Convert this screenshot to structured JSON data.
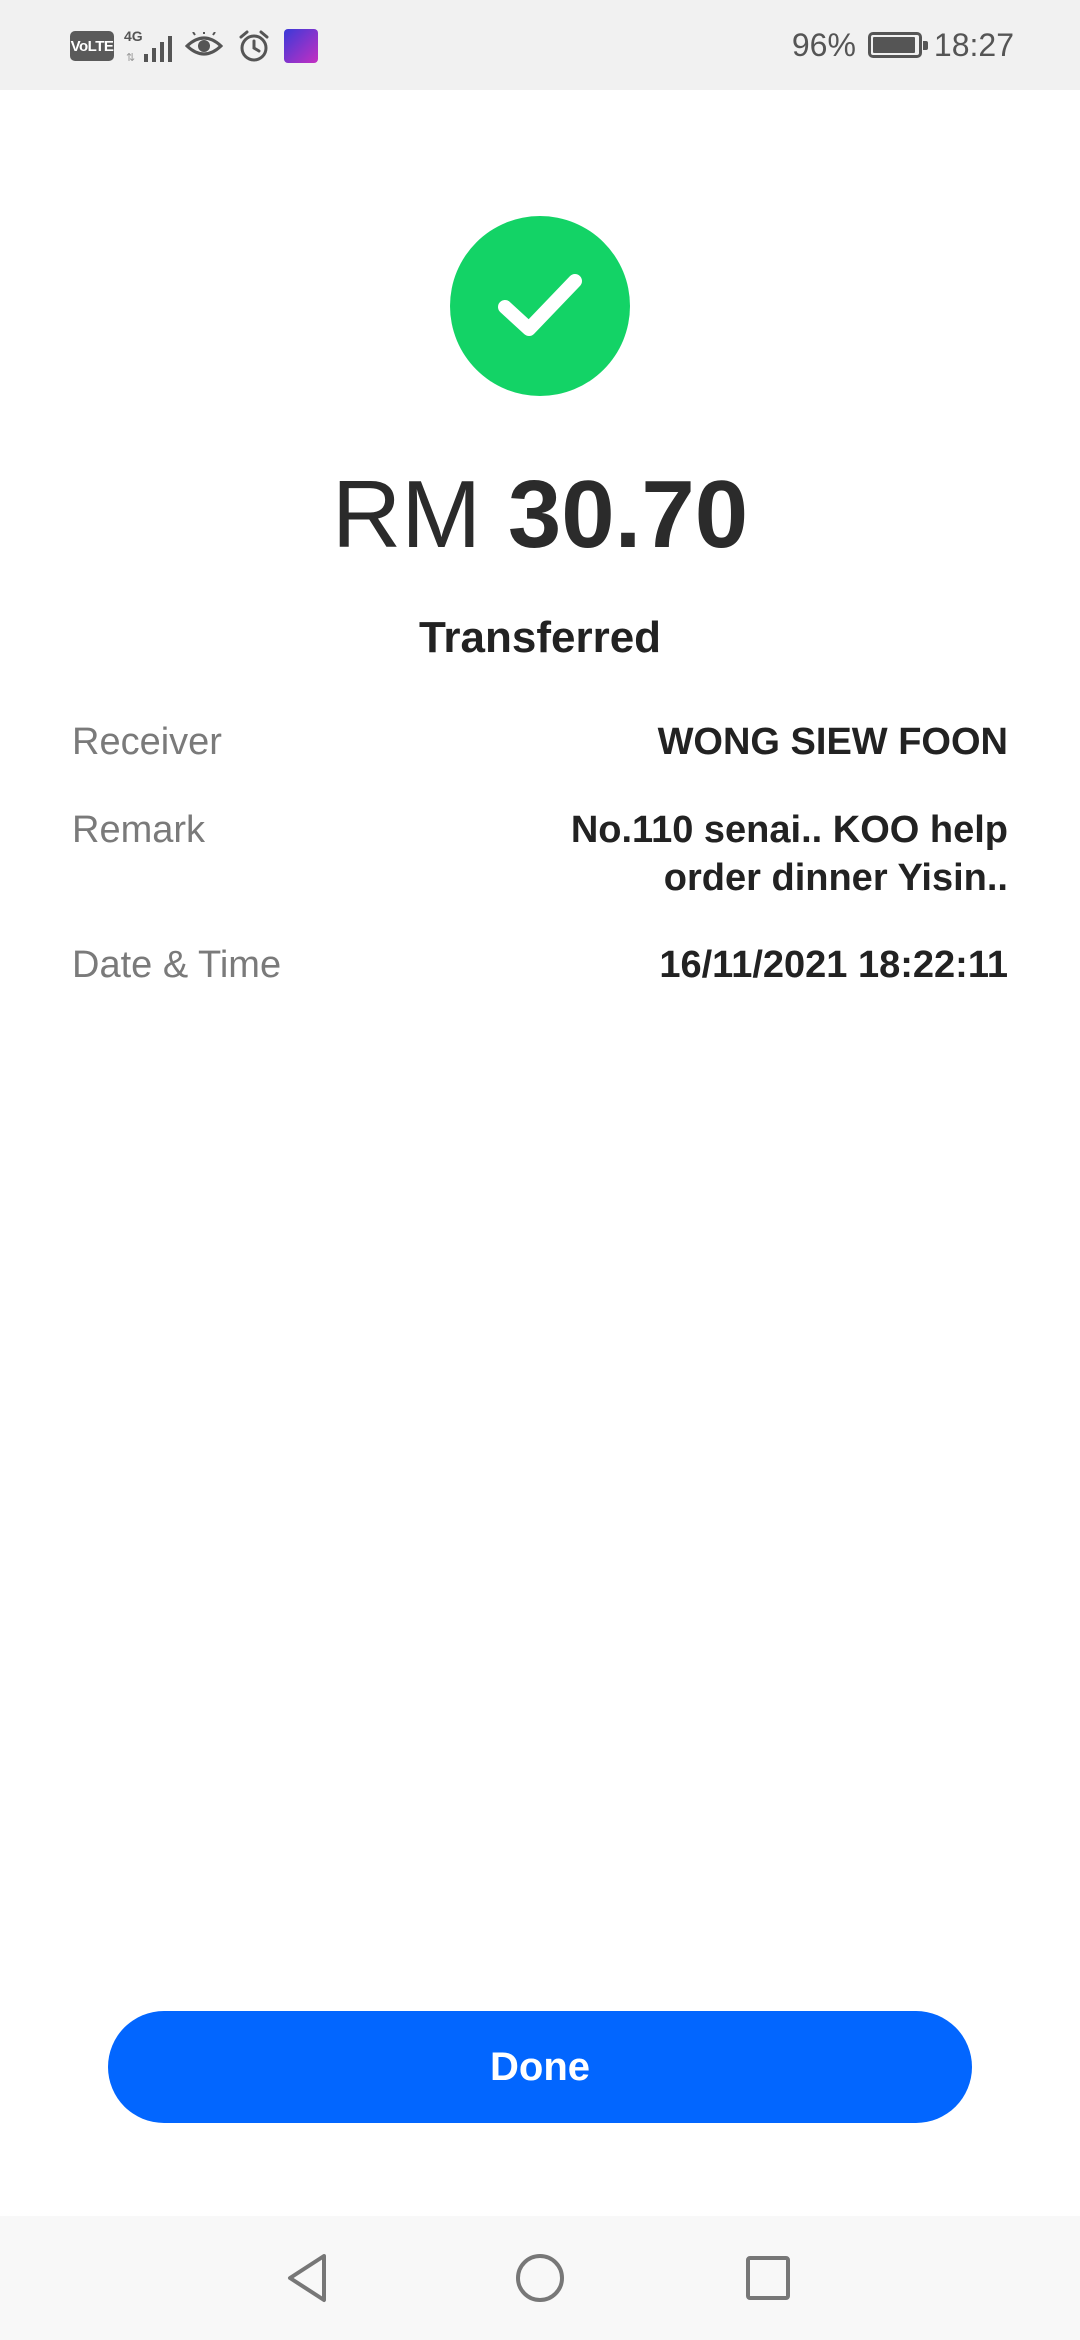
{
  "status_bar": {
    "volte_label": "VoLTE",
    "network_label": "4G",
    "battery_percent": "96%",
    "battery_level": 0.96,
    "time": "18:27",
    "icons": [
      "volte-icon",
      "network-4g-icon",
      "signal-icon",
      "eye-icon",
      "alarm-icon",
      "app-notification-icon",
      "battery-icon"
    ]
  },
  "transfer": {
    "status_icon": "check-circle-icon",
    "status_color": "#13d366",
    "currency": "RM",
    "amount": "30.70",
    "status_text": "Transferred"
  },
  "details": {
    "receiver_label": "Receiver",
    "receiver_value": "WONG SIEW FOON",
    "remark_label": "Remark",
    "remark_line1": "No.110 senai.. KOO help",
    "remark_line2": "order dinner Yisin..",
    "datetime_label": "Date & Time",
    "datetime_value": "16/11/2021 18:22:11"
  },
  "actions": {
    "done_label": "Done",
    "done_color": "#0266ff"
  },
  "nav_bar": {
    "icons": [
      "back-icon",
      "home-icon",
      "recent-apps-icon"
    ]
  }
}
